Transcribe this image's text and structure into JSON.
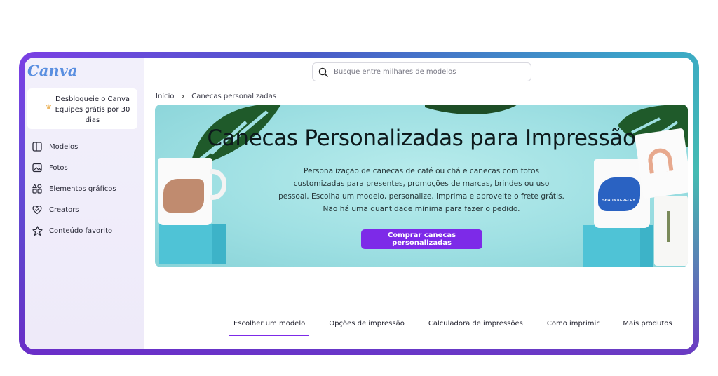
{
  "sidebar": {
    "logo": "Canva",
    "promo": "Desbloqueie o Canva Equipes grátis por 30 dias",
    "items": [
      {
        "label": "Modelos",
        "icon": "templates-icon"
      },
      {
        "label": "Fotos",
        "icon": "photo-icon"
      },
      {
        "label": "Elementos gráficos",
        "icon": "shapes-icon"
      },
      {
        "label": "Creators",
        "icon": "heart-badge-icon"
      },
      {
        "label": "Conteúdo favorito",
        "icon": "star-icon"
      }
    ]
  },
  "search": {
    "placeholder": "Busque entre milhares de modelos"
  },
  "breadcrumb": {
    "home": "Início",
    "current": "Canecas personalizadas"
  },
  "hero": {
    "title": "Canecas Personalizadas para Impressão",
    "description": "Personalização de canecas de café ou chá e canecas com fotos customizadas para presentes, promoções de marcas, brindes ou uso pessoal. Escolha um modelo, personalize, imprima e aproveite o frete grátis. Não há uma quantidade mínima para fazer o pedido.",
    "button": "Comprar canecas personalizadas",
    "mug_text": "SHAUN KEVELEY"
  },
  "tabs": [
    "Escolher um modelo",
    "Opções de impressão",
    "Calculadora de impressões",
    "Como imprimir",
    "Mais produtos"
  ],
  "colors": {
    "accent": "#7d2ae8",
    "hero_bg": "#9fe0e3"
  }
}
